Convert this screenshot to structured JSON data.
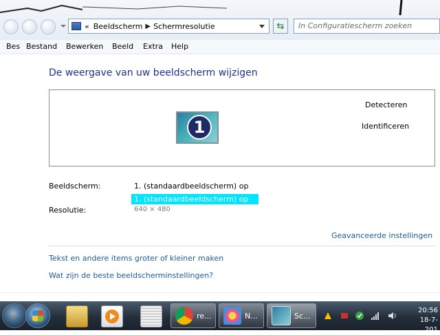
{
  "window": {
    "breadcrumb_prefix": "«",
    "breadcrumbs": [
      "Beeldscherm",
      "Schermresolutie"
    ],
    "search_placeholder": "In Configuratiescherm zoeken"
  },
  "menu": [
    "Bes",
    "Bestand",
    "Bewerken",
    "Beeld",
    "Extra",
    "Help"
  ],
  "content": {
    "heading": "De weergave van uw beeldscherm wijzigen",
    "monitor_number": "1",
    "detect_label": "Detecteren",
    "identify_label": "Identificeren",
    "display_label": "Beeldscherm:",
    "display_value": "1. (standaardbeeldscherm) op",
    "display_option": "1. (standaardbeeldscherm) op",
    "resolution_label": "Resolutie:",
    "resolution_value": "640 × 480",
    "advanced_link": "Geavanceerde instellingen",
    "link_text_size": "Tekst en andere items groter of kleiner maken",
    "link_best_settings": "Wat zijn de beste beeldscherminstellingen?"
  },
  "taskbar": {
    "tasks": [
      {
        "label": "re..."
      },
      {
        "label": "N..."
      },
      {
        "label": "Sc..."
      }
    ],
    "clock_time": "20:56",
    "clock_date": "18-7-201"
  },
  "colors": {
    "heading": "#1e3287",
    "link": "#1e5a99",
    "dropdown_highlight": "#00e5ff",
    "taskbar": "#232e3b"
  },
  "icons": [
    "back-icon",
    "forward-icon",
    "control-panel-icon",
    "refresh-icon",
    "monitor-icon",
    "windows-logo-icon",
    "explorer-icon",
    "media-player-icon",
    "documents-icon",
    "chrome-icon",
    "paint-icon",
    "display-settings-icon",
    "volume-icon",
    "network-icon"
  ]
}
